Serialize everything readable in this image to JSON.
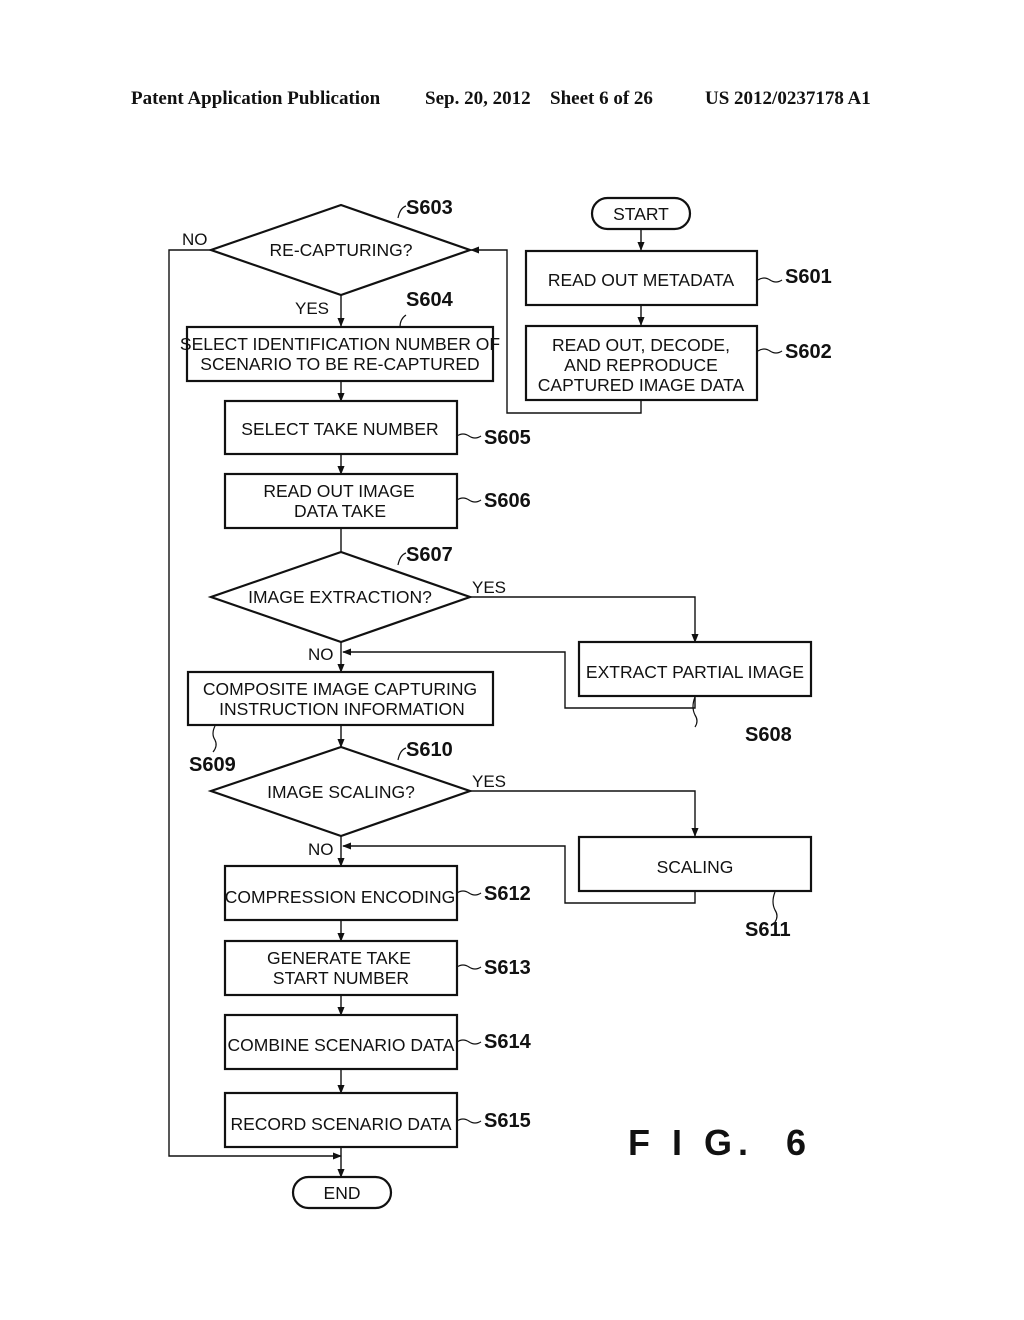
{
  "header": {
    "publication": "Patent Application Publication",
    "date": "Sep. 20, 2012",
    "sheet": "Sheet 6 of 26",
    "number": "US 2012/0237178 A1"
  },
  "figure_label": "F I G.  6",
  "terminals": {
    "start": "START",
    "end": "END"
  },
  "steps": {
    "s601": {
      "id": "S601",
      "lines": [
        "READ OUT METADATA"
      ]
    },
    "s602": {
      "id": "S602",
      "lines": [
        "READ OUT, DECODE,",
        "AND REPRODUCE",
        "CAPTURED IMAGE DATA"
      ]
    },
    "s603": {
      "id": "S603",
      "lines": [
        "RE-CAPTURING?"
      ]
    },
    "s604": {
      "id": "S604",
      "lines": [
        "SELECT IDENTIFICATION NUMBER OF",
        "SCENARIO TO BE RE-CAPTURED"
      ]
    },
    "s605": {
      "id": "S605",
      "lines": [
        "SELECT TAKE NUMBER"
      ]
    },
    "s606": {
      "id": "S606",
      "lines": [
        "READ OUT IMAGE",
        "DATA TAKE"
      ]
    },
    "s607": {
      "id": "S607",
      "lines": [
        "IMAGE EXTRACTION?"
      ]
    },
    "s608": {
      "id": "S608",
      "lines": [
        "EXTRACT PARTIAL IMAGE"
      ]
    },
    "s609": {
      "id": "S609",
      "lines": [
        "COMPOSITE IMAGE CAPTURING",
        "INSTRUCTION INFORMATION"
      ]
    },
    "s610": {
      "id": "S610",
      "lines": [
        "IMAGE SCALING?"
      ]
    },
    "s611": {
      "id": "S611",
      "lines": [
        "SCALING"
      ]
    },
    "s612": {
      "id": "S612",
      "lines": [
        "COMPRESSION ENCODING"
      ]
    },
    "s613": {
      "id": "S613",
      "lines": [
        "GENERATE TAKE",
        "START NUMBER"
      ]
    },
    "s614": {
      "id": "S614",
      "lines": [
        "COMBINE SCENARIO DATA"
      ]
    },
    "s615": {
      "id": "S615",
      "lines": [
        "RECORD SCENARIO DATA"
      ]
    }
  },
  "branches": {
    "s603_no": "NO",
    "s603_yes": "YES",
    "s607_yes": "YES",
    "s607_no": "NO",
    "s610_yes": "YES",
    "s610_no": "NO"
  }
}
